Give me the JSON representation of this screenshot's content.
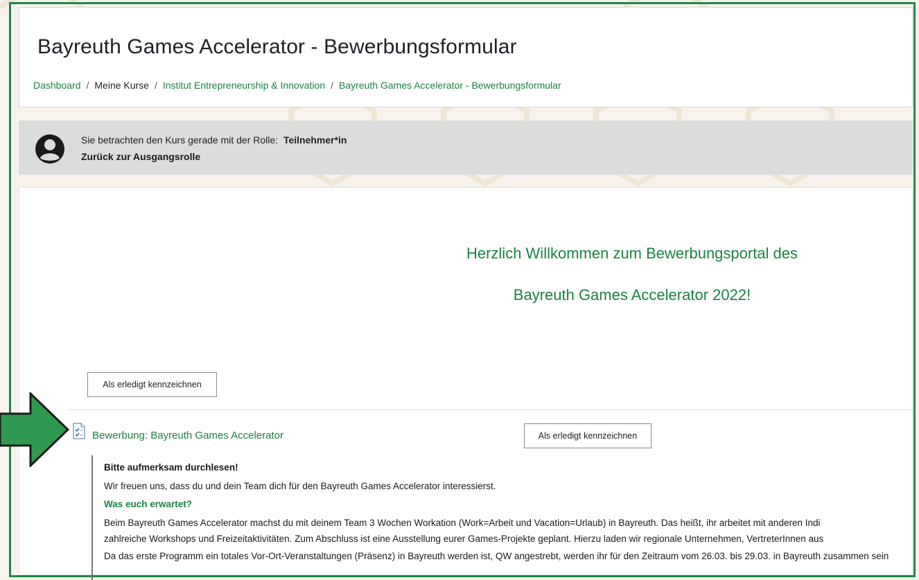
{
  "header": {
    "title": "Bayreuth Games Accelerator - Bewerbungsformular",
    "breadcrumb": {
      "dashboard": "Dashboard",
      "my_courses": "Meine Kurse",
      "institute": "Institut Entrepreneurship & Innovation",
      "course": "Bayreuth Games Accelerator - Bewerbungsformular",
      "separator": "/"
    }
  },
  "role": {
    "text": "Sie betrachten den Kurs gerade mit der Rolle:",
    "role_name": "Teilnehmer*in",
    "return_link": "Zurück zur Ausgangsrolle"
  },
  "main": {
    "welcome_line1": "Herzlich Willkommen zum Bewerbungsportal des",
    "welcome_line2": "Bayreuth Games Accelerator 2022!",
    "mark_done_label": "Als erledigt kennzeichnen"
  },
  "activity": {
    "title": "Bewerbung: Bayreuth Games Accelerator",
    "icon": "feedback-form-icon",
    "mark_done_label": "Als erledigt kennzeichnen",
    "description": {
      "p1": "Bitte aufmerksam durchlesen!",
      "p2": "Wir freuen uns, dass du und dein Team dich für den Bayreuth Games Accelerator interessierst.",
      "heading": "Was euch erwartet?",
      "p3": "Beim Bayreuth Games Accelerator machst du mit deinem Team 3 Wochen Workation (Work=Arbeit und Vacation=Urlaub) in Bayreuth. Das heißt, ihr arbeitet mit anderen Indi",
      "p4": "zahlreiche Workshops und Freizeitaktivitäten. Zum Abschluss ist eine Ausstellung eurer Games-Projekte geplant. Hierzu laden wir regionale Unternehmen, VertreterInnen aus",
      "p5": "Da das erste Programm ein totales Vor-Ort-Veranstaltungen (Präsenz) in Bayreuth werden ist, QW angestrebt, werden ihr für den Zeitraum vom 26.03. bis 29.03. in Bayreuth zusammen sein"
    }
  },
  "colors": {
    "accent_green": "#1c8142",
    "frame_green": "#1e8a4a",
    "arrow_green": "#2f9a4f",
    "role_bar": "#dcdcdc"
  }
}
